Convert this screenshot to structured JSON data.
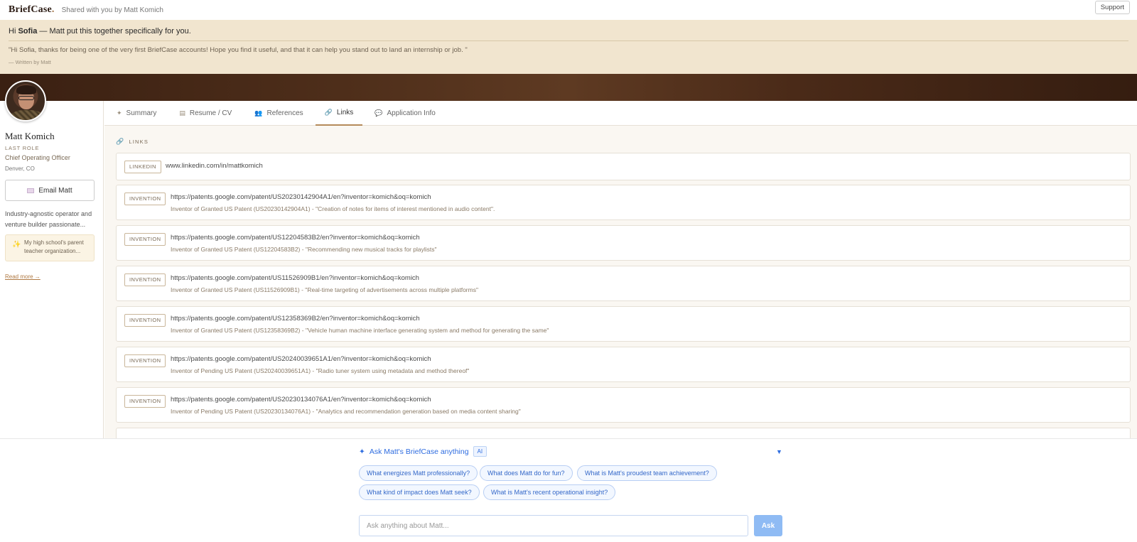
{
  "topbar": {
    "logo": "BriefCase",
    "logo_dot": ".",
    "shared_text": "Shared with you by Matt Komich",
    "support_label": "Support"
  },
  "greeting": {
    "hi": "Hi",
    "name": "Sofia",
    "rest": "— Matt put this together specifically for you.",
    "quote": "\"Hi Sofia, thanks for being one of the very first BriefCase accounts! Hope you find it useful, and that it can help you stand out to land an internship or job. \"",
    "author": "— Written by Matt"
  },
  "profile": {
    "name": "Matt Komich",
    "last_role_label": "LAST ROLE",
    "role": "Chief Operating Officer",
    "location": "Denver, CO",
    "email_label": "Email Matt",
    "bio": "Industry-agnostic operator and venture builder passionate...",
    "highlight": "My high school's parent teacher organization...",
    "read_more": "Read more →"
  },
  "tabs": [
    {
      "label": "Summary",
      "icon": "✦"
    },
    {
      "label": "Resume / CV",
      "icon": "▤"
    },
    {
      "label": "References",
      "icon": "👥"
    },
    {
      "label": "Links",
      "icon": "🔗"
    },
    {
      "label": "Application Info",
      "icon": "💬"
    }
  ],
  "active_tab": "Links",
  "links_section": {
    "label": "LINKS",
    "items": [
      {
        "tag": "LINKEDIN",
        "url": "www.linkedin.com/in/mattkomich",
        "desc": ""
      },
      {
        "tag": "INVENTION",
        "url": "https://patents.google.com/patent/US20230142904A1/en?inventor=komich&oq=komich",
        "desc": "Inventor of Granted US Patent (US20230142904A1) - \"Creation of notes for items of interest mentioned in audio content\"."
      },
      {
        "tag": "INVENTION",
        "url": "https://patents.google.com/patent/US12204583B2/en?inventor=komich&oq=komich",
        "desc": "Inventor of Granted US Patent (US12204583B2) - \"Recommending new musical tracks for playlists\""
      },
      {
        "tag": "INVENTION",
        "url": "https://patents.google.com/patent/US11526909B1/en?inventor=komich&oq=komich",
        "desc": "Inventor of Granted US Patent (US11526909B1) - \"Real-time targeting of advertisements across multiple platforms\""
      },
      {
        "tag": "INVENTION",
        "url": "https://patents.google.com/patent/US12358369B2/en?inventor=komich&oq=komich",
        "desc": "Inventor of Granted US Patent (US12358369B2) - \"Vehicle human machine interface generating system and method for generating the same\""
      },
      {
        "tag": "INVENTION",
        "url": "https://patents.google.com/patent/US20240039651A1/en?inventor=komich&oq=komich",
        "desc": "Inventor of Pending US Patent (US20240039651A1) - \"Radio tuner system using metadata and method thereof\""
      },
      {
        "tag": "INVENTION",
        "url": "https://patents.google.com/patent/US20230134076A1/en?inventor=komich&oq=komich",
        "desc": "Inventor of Pending US Patent (US20230134076A1) - \"Analytics and recommendation generation based on media content sharing\""
      }
    ]
  },
  "ai": {
    "title": "Ask Matt's BriefCase anything",
    "badge": "AI",
    "suggestions_row1": [
      "What energizes Matt professionally?",
      "What does Matt do for fun?",
      "What is Matt's proudest team achievement?"
    ],
    "suggestions_row2": [
      "What kind of impact does Matt seek?",
      "What is Matt's recent operational insight?"
    ],
    "input_placeholder": "Ask anything about Matt...",
    "ask_label": "Ask"
  },
  "colors": {
    "accent_brown": "#b58a5a",
    "banner_bg": "#f1e5cf",
    "ai_blue": "#2f6de0",
    "ask_button": "#8fbbf4"
  }
}
